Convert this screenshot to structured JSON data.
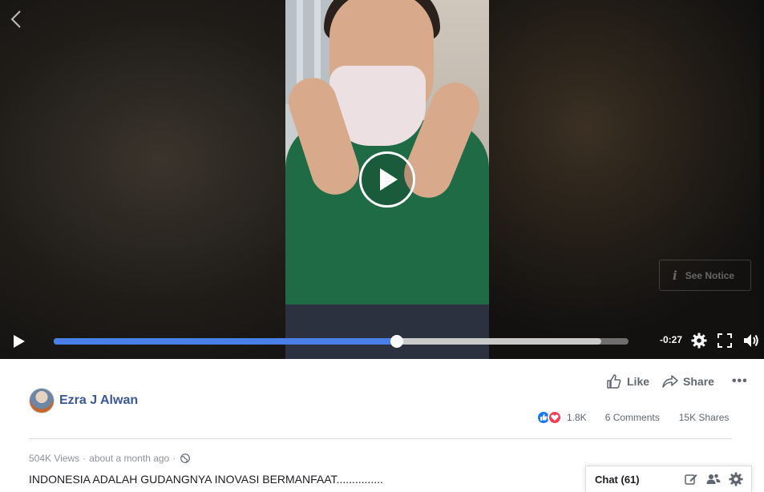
{
  "video": {
    "time_remaining": "-0:27",
    "played_fraction": 0.597,
    "buffered_fraction": 0.953,
    "see_notice_label": "See Notice"
  },
  "post": {
    "author_name": "Ezra J Alwan",
    "like_label": "Like",
    "share_label": "Share",
    "reaction_count": "1.8K",
    "comments": "6 Comments",
    "shares": "15K Shares",
    "views": "504K Views",
    "time_ago": "about a month ago",
    "caption": "INDONESIA ADALAH GUDANGNYA INOVASI BERMANFAAT..............."
  },
  "chat": {
    "label": "Chat (61)"
  },
  "colors": {
    "progress": "#4a7fe8",
    "link": "#385898",
    "like_reaction": "#1877f2",
    "love_reaction": "#f33e58"
  },
  "icons": [
    "back-chevron-icon",
    "play-icon",
    "settings-gear-icon",
    "fullscreen-icon",
    "volume-icon",
    "info-icon",
    "thumbs-up-icon",
    "share-arrow-icon",
    "more-dots-icon",
    "globe-icon",
    "compose-icon",
    "group-chat-icon",
    "chat-settings-icon"
  ]
}
